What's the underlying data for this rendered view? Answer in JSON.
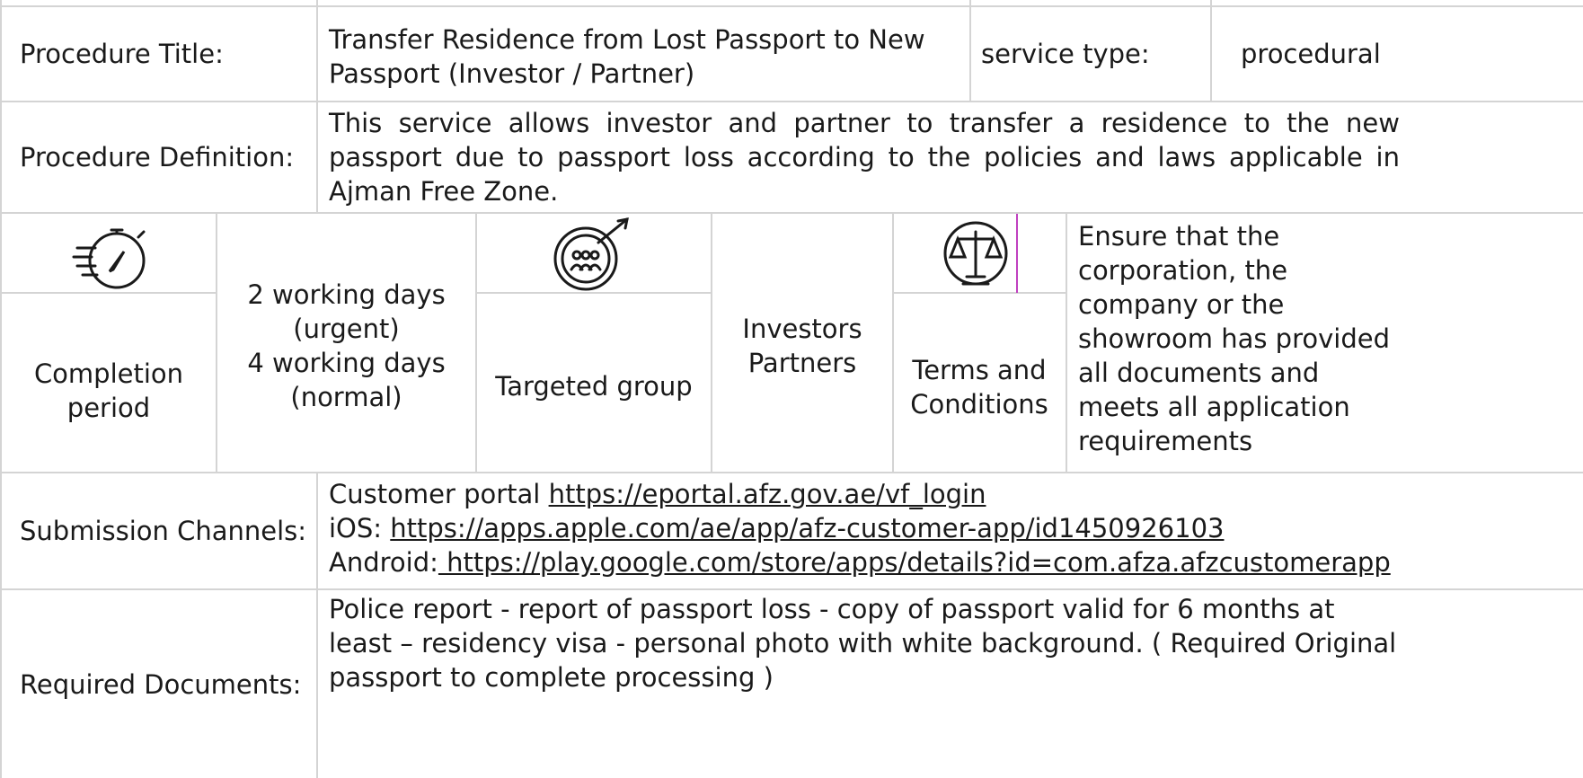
{
  "procedure": {
    "title_label": "Procedure Title:",
    "title_value": "Transfer Residence from Lost Passport to New Passport (Investor / Partner)",
    "service_type_label": "service type:",
    "service_type_value": "procedural",
    "definition_label": "Procedure Definition:",
    "definition_value": "This service allows investor and partner to transfer a residence to the new passport due to passport loss according to the policies and laws applicable in Ajman Free Zone."
  },
  "details": {
    "completion_icon": "stopwatch-icon",
    "completion_label": "Completion period",
    "completion_line1": "2 working days",
    "completion_line2": "(urgent)",
    "completion_line3": "4 working days",
    "completion_line4": "(normal)",
    "target_icon": "target-group-icon",
    "target_label": "Targeted group",
    "target_line1": "Investors",
    "target_line2": "Partners",
    "terms_icon": "scales-of-justice-icon",
    "terms_label": "Terms and Conditions",
    "terms_value": "Ensure that the corporation, the company or the showroom has provided all documents and meets all application requirements"
  },
  "submission": {
    "label": "Submission Channels:",
    "portal_prefix": "Customer portal ",
    "portal_link": "https://eportal.afz.gov.ae/vf_login",
    "ios_prefix": "iOS: ",
    "ios_link": "https://apps.apple.com/ae/app/afz-customer-app/id1450926103",
    "android_prefix": "Android:",
    "android_link": " https://play.google.com/store/apps/details?id=com.afza.afzcustomerapp"
  },
  "documents": {
    "label": "Required Documents:",
    "value": " Police report - report of passport loss - copy of passport valid for 6 months at least – residency visa - personal photo with white background. ( Required Original passport to complete processing )"
  },
  "colors": {
    "border": "#d4d4d4",
    "text": "#1a1a1a",
    "accent_mark": "#c040c0"
  }
}
